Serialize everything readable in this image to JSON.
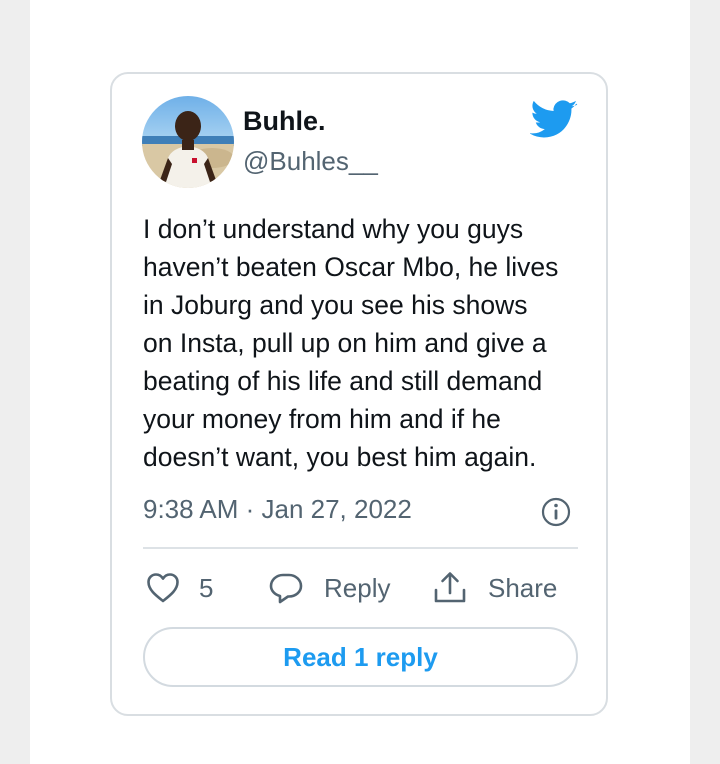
{
  "tweet": {
    "display_name": "Buhle.",
    "handle": "@Buhles__",
    "text_lines": [
      "I don’t understand why you guys",
      "haven’t beaten Oscar Mbo, he lives",
      "in Joburg and you see his shows",
      "on Insta, pull up on him and give a",
      "beating of his life and still demand",
      "your money from him and if he",
      "doesn’t want, you best him again."
    ],
    "timestamp": "9:38 AM · Jan 27, 2022",
    "like_count": "5",
    "reply_label": "Reply",
    "share_label": "Share",
    "read_replies_label": "Read 1 reply"
  },
  "icons": {
    "logo": "twitter-bird-icon",
    "info": "info-icon",
    "like": "heart-icon",
    "reply": "speech-bubble-icon",
    "share": "share-upload-icon"
  },
  "colors": {
    "brand_blue": "#1d9bf0",
    "text_primary": "#0f1419",
    "text_secondary": "#536471",
    "border": "#d9dee2"
  }
}
